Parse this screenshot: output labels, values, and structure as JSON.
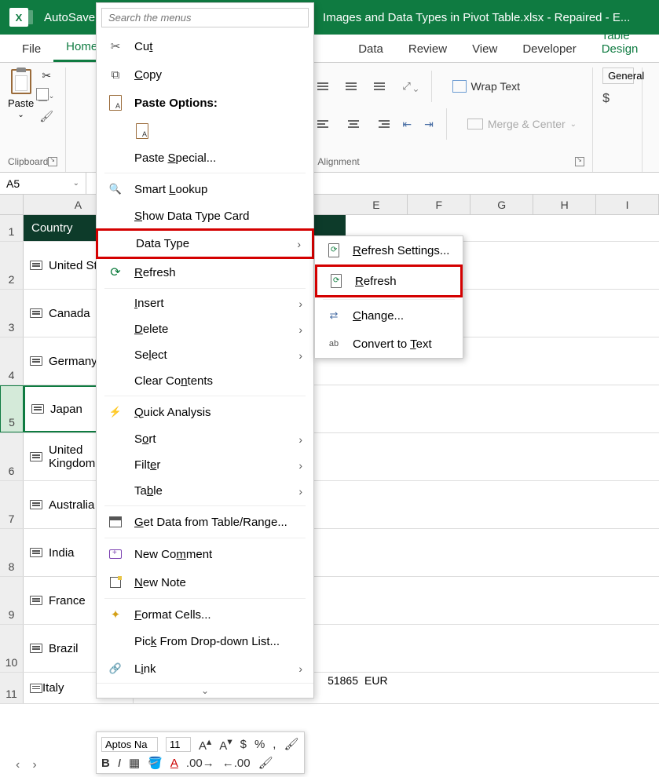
{
  "titlebar": {
    "autosave": "AutoSave",
    "filename": "Images and Data Types in Pivot Table.xlsx  -  Repaired  -  E..."
  },
  "tabs": {
    "file": "File",
    "home": "Home",
    "data": "Data",
    "review": "Review",
    "view": "View",
    "developer": "Developer",
    "table_design": "Table Design"
  },
  "ribbon": {
    "clipboard": {
      "paste": "Paste",
      "label": "Clipboard"
    },
    "alignment": {
      "wrap": "Wrap Text",
      "merge": "Merge & Center",
      "label": "Alignment"
    },
    "number": {
      "format": "General"
    }
  },
  "namebox": "A5",
  "columns": [
    "A",
    "E",
    "F",
    "G",
    "H",
    "I"
  ],
  "header_cell": "Country",
  "rows": [
    {
      "n": "2",
      "val": "United States"
    },
    {
      "n": "3",
      "val": "Canada"
    },
    {
      "n": "4",
      "val": "Germany"
    },
    {
      "n": "5",
      "val": "Japan"
    },
    {
      "n": "6",
      "val": "United Kingdom"
    },
    {
      "n": "7",
      "val": "Australia"
    },
    {
      "n": "8",
      "val": "India"
    },
    {
      "n": "9",
      "val": "France"
    },
    {
      "n": "10",
      "val": "Brazil"
    }
  ],
  "row11": {
    "n": "11",
    "val": "Italy",
    "num": "51865",
    "cur": "EUR"
  },
  "ctx": {
    "search_ph": "Search the menus",
    "cut": "Cut",
    "copy": "Copy",
    "paste_options": "Paste Options:",
    "paste_special": "Paste Special...",
    "smart_lookup": "Smart Lookup",
    "show_card": "Show Data Type Card",
    "data_type": "Data Type",
    "refresh": "Refresh",
    "insert": "Insert",
    "delete": "Delete",
    "select": "Select",
    "clear": "Clear Contents",
    "quick": "Quick Analysis",
    "sort": "Sort",
    "filter": "Filter",
    "table": "Table",
    "get_data": "Get Data from Table/Range...",
    "new_comment": "New Comment",
    "new_note": "New Note",
    "format_cells": "Format Cells...",
    "pick": "Pick From Drop-down List...",
    "link": "Link"
  },
  "submenu": {
    "refresh_settings": "Refresh Settings...",
    "refresh": "Refresh",
    "change": "Change...",
    "convert": "Convert to Text"
  },
  "mini": {
    "font": "Aptos Na",
    "size": "11"
  }
}
